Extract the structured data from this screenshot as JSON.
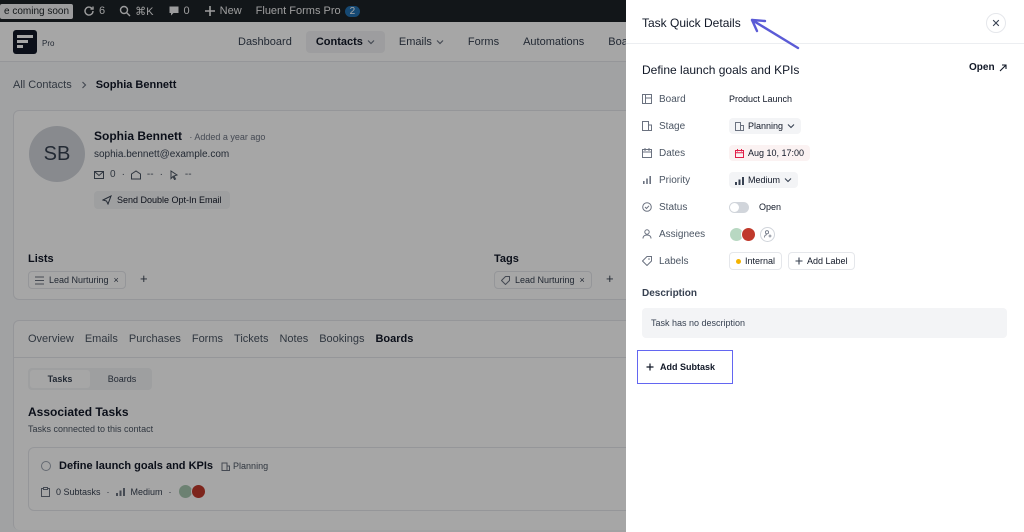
{
  "admin_bar": {
    "coming_soon": "e coming soon",
    "updates_count": "6",
    "shortcut": "⌘K",
    "comments_count": "0",
    "new_label": "New",
    "plugin_label": "Fluent Forms Pro",
    "plugin_badge": "2"
  },
  "nav": {
    "pro_label": "Pro",
    "items": [
      {
        "label": "Dashboard"
      },
      {
        "label": "Contacts"
      },
      {
        "label": "Emails"
      },
      {
        "label": "Forms"
      },
      {
        "label": "Automations"
      },
      {
        "label": "Boar"
      }
    ]
  },
  "breadcrumb": {
    "root": "All Contacts",
    "current": "Sophia Bennett"
  },
  "profile": {
    "initials": "SB",
    "name": "Sophia Bennett",
    "added": "Added a year ago",
    "email": "sophia.bennett@example.com",
    "emails_sent": "0",
    "opens": "--",
    "clicks": "--",
    "optin_button": "Send Double Opt-In Email",
    "lists_label": "Lists",
    "tags_label": "Tags",
    "list_chip": "Lead Nurturing",
    "tag_chip": "Lead Nurturing"
  },
  "tabs": {
    "items": [
      "Overview",
      "Emails",
      "Purchases",
      "Forms",
      "Tickets",
      "Notes",
      "Bookings",
      "Boards"
    ],
    "active": "Boards",
    "segment": [
      "Tasks",
      "Boards"
    ],
    "assoc_title": "Associated Tasks",
    "assoc_sub": "Tasks connected to this contact",
    "task": {
      "title": "Define launch goals and KPIs",
      "stage": "Planning",
      "subtasks": "0 Subtasks",
      "priority": "Medium"
    }
  },
  "drawer": {
    "title": "Task Quick Details",
    "task_title": "Define launch goals and KPIs",
    "open_label": "Open",
    "fields": {
      "board_label": "Board",
      "board_value": "Product Launch",
      "stage_label": "Stage",
      "stage_value": "Planning",
      "dates_label": "Dates",
      "dates_value": "Aug 10, 17:00",
      "priority_label": "Priority",
      "priority_value": "Medium",
      "status_label": "Status",
      "status_value": "Open",
      "assignees_label": "Assignees",
      "labels_label": "Labels",
      "label_value": "Internal",
      "add_label": "Add Label"
    },
    "description_label": "Description",
    "description_text": "Task has no description",
    "add_subtask": "Add Subtask"
  },
  "colors": {
    "accent_outline": "#6366f1",
    "label_dot": "#f5b400",
    "date_icon": "#e11d48"
  }
}
